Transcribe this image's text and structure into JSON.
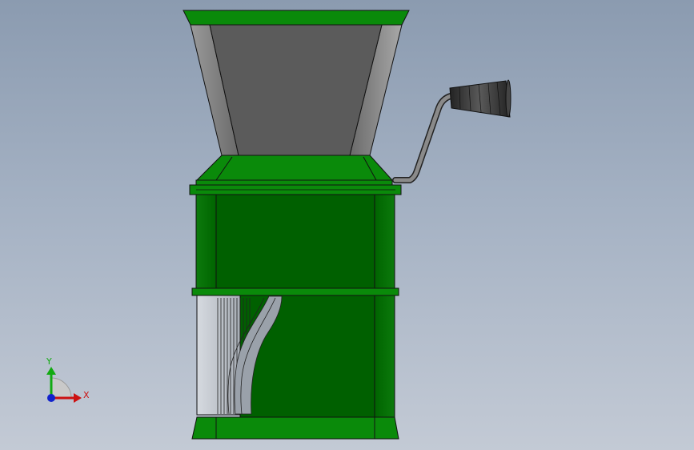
{
  "viewport": {
    "background_top": "#8b9bb0",
    "background_bottom": "#c3cad5"
  },
  "model": {
    "body_color": "#006000",
    "body_highlight": "#0a8a0a",
    "hopper_color": "#5a5a5a",
    "handle_color": "#3a3a3a"
  },
  "triad": {
    "x_label": "X",
    "y_label": "Y",
    "x_color": "#cc1111",
    "y_color": "#11aa11",
    "z_color": "#1122cc"
  }
}
